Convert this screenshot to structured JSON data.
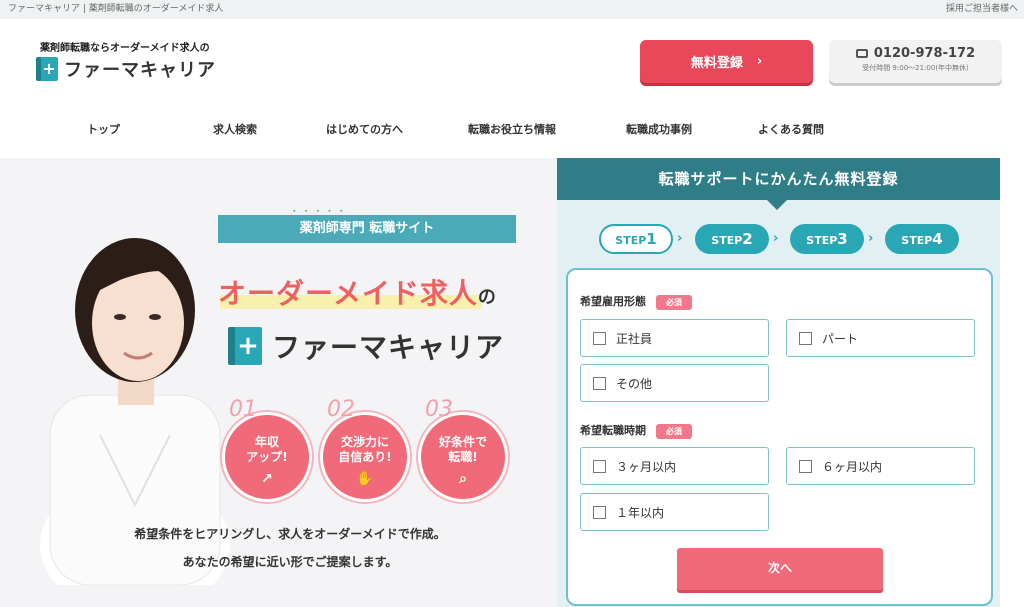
{
  "topbar": {
    "site_title": "ファーマキャリア | 薬剤師転職のオーダーメイド求人",
    "employer_link": "採用ご担当者様へ"
  },
  "header": {
    "tagline": "薬剤師転職ならオーダーメイド求人の",
    "logo_text": "ファーマキャリア",
    "register_label": "無料登録",
    "phone": "0120-978-172",
    "hours": "受付時間 9:00〜21:00(年中無休)"
  },
  "nav": [
    "トップ",
    "求人検索",
    "はじめての方へ",
    "転職お役立ち情報",
    "転職成功事例",
    "よくある質問"
  ],
  "hero": {
    "banner": "薬剤師専門 転職サイト",
    "headline": "オーダーメイド求人",
    "headline_suffix": "の",
    "logo_text": "ファーマキャリア",
    "badges": [
      {
        "num": "01",
        "text1": "年収",
        "text2": "アップ!",
        "icon": "chart-icon"
      },
      {
        "num": "02",
        "text1": "交渉力に",
        "text2": "自信あり!",
        "icon": "handshake-icon"
      },
      {
        "num": "03",
        "text1": "好条件で",
        "text2": "転職!",
        "icon": "search-icon"
      }
    ],
    "desc1": "希望条件をヒアリングし、求人をオーダーメイドで作成。",
    "desc2": "あなたの希望に近い形でご提案します。"
  },
  "panel": {
    "title": "転職サポートにかんたん無料登録",
    "steps": [
      {
        "label": "STEP",
        "num": "1"
      },
      {
        "label": "STEP",
        "num": "2"
      },
      {
        "label": "STEP",
        "num": "3"
      },
      {
        "label": "STEP",
        "num": "4"
      }
    ],
    "q1": {
      "label": "希望雇用形態",
      "req": "必須",
      "options": [
        "正社員",
        "パート",
        "その他"
      ]
    },
    "q2": {
      "label": "希望転職時期",
      "req": "必須",
      "options": [
        "３ヶ月以内",
        "６ヶ月以内",
        "１年以内"
      ]
    },
    "next_label": "次へ"
  },
  "colors": {
    "accent": "#2aa7b4",
    "cta": "#e8485a",
    "panel_header": "#2f7d86"
  }
}
